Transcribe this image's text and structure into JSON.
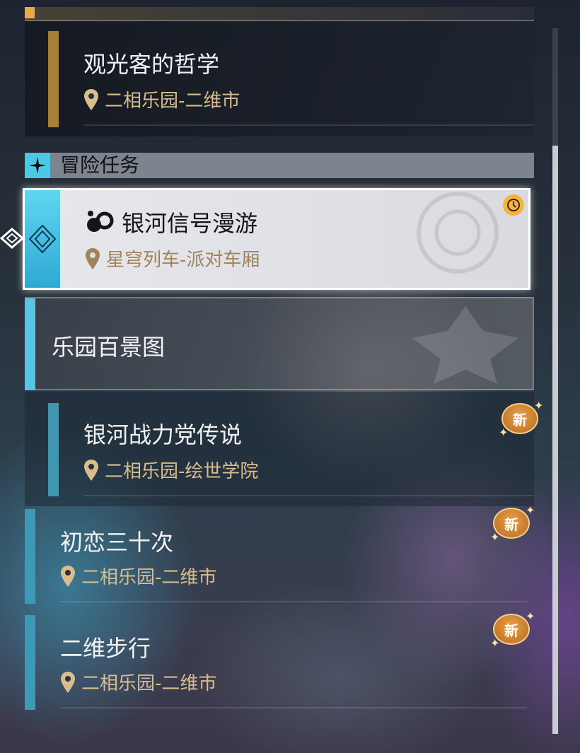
{
  "quests": {
    "q1": {
      "title": "观光客的哲学",
      "location": "二相乐园-二维市"
    },
    "category": {
      "label": "冒险任务"
    },
    "q2": {
      "title": "银河信号漫游",
      "location": "星穹列车-派对车厢",
      "selected": true,
      "timed": true
    },
    "group": {
      "title": "乐园百景图"
    },
    "q3": {
      "title": "银河战力党传说",
      "location": "二相乐园-绘世学院",
      "badge": "新"
    },
    "q4": {
      "title": "初恋三十次",
      "location": "二相乐园-二维市",
      "badge": "新"
    },
    "q5": {
      "title": "二维步行",
      "location": "二相乐园-二维市",
      "badge": "新"
    }
  },
  "colors": {
    "accent_cyan": "#58c6e3",
    "gold_bar": "#a68133",
    "location_text": "#d8bd8e",
    "badge_orange": "#e8a24a"
  },
  "icons": [
    "location-pin-icon",
    "adventure-diamond-icon",
    "quest-type-icon",
    "clock-icon",
    "new-badge-icon"
  ]
}
